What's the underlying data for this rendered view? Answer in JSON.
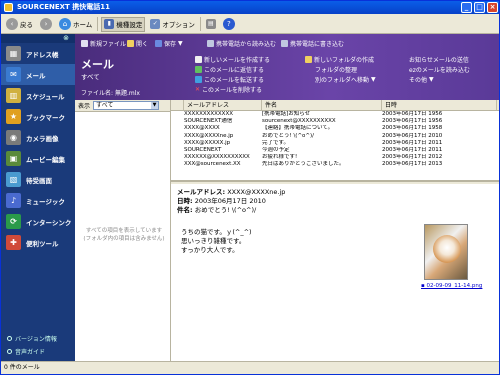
{
  "window": {
    "title": "SOURCENEXT 携快電話11"
  },
  "toolbar": {
    "back": "戻る",
    "home": "ホーム",
    "model_settings": "機種設定",
    "options": "オプション"
  },
  "sidebar": {
    "items": [
      {
        "label": "アドレス帳",
        "icon": "address-book-icon",
        "color": "#8a8a8a"
      },
      {
        "label": "メール",
        "icon": "mail-icon",
        "color": "#3a7ad0"
      },
      {
        "label": "スケジュール",
        "icon": "calendar-icon",
        "color": "#d0b040"
      },
      {
        "label": "ブックマーク",
        "icon": "star-icon",
        "color": "#e0a020"
      },
      {
        "label": "カメラ画像",
        "icon": "camera-icon",
        "color": "#7a7a7a"
      },
      {
        "label": "ムービー編集",
        "icon": "film-icon",
        "color": "#5a8a3a"
      },
      {
        "label": "待受画面",
        "icon": "wallpaper-icon",
        "color": "#4a9ad0"
      },
      {
        "label": "ミュージック",
        "icon": "music-icon",
        "color": "#4a6ad0"
      },
      {
        "label": "インターシンク",
        "icon": "sync-icon",
        "color": "#2a9a4a"
      },
      {
        "label": "便利ツール",
        "icon": "tools-icon",
        "color": "#d04a3a"
      }
    ],
    "version_info": "バージョン情報",
    "help": "音声ガイド"
  },
  "header": {
    "title": "メール",
    "subtitle": "すべて",
    "file_label": "ファイル名:",
    "file_name": "無題.mlx",
    "new_file": "新規ファイル",
    "open": "開く",
    "save": "保存",
    "read_from_phone": "携帯電話から読み込む",
    "write_to_phone": "携帯電話に書き込む",
    "actions": {
      "create_mail": "新しいメールを作成する",
      "reply": "このメールに返信する",
      "forward": "このメールを転送する",
      "delete": "このメールを削除する",
      "new_folder": "新しいフォルダの作成",
      "organize_folders": "フォルダの整理",
      "move_folder": "別のフォルダへ移動",
      "notify_send": "お知らせメールの送信",
      "read_ez_mail": "ezのメールを読み込む",
      "other": "その他"
    }
  },
  "left_pane": {
    "display_label": "表示",
    "filter_value": "すべて",
    "empty_line1": "すべての項目を表示しています",
    "empty_line2": "(フォルダ内の項目は含みません)"
  },
  "mail_list": {
    "columns": [
      "",
      "メールアドレス",
      "件名",
      "日時"
    ],
    "rows": [
      {
        "address": "XXXXXXXXXXXXX",
        "subject": "[携帯電話]お知らせ",
        "date": "2003年06月17日 1956"
      },
      {
        "address": "SOURCENEXT通信",
        "subject": "sourcenext@XXXXXXXXXX",
        "date": "2003年06月17日 1956"
      },
      {
        "address": "XXXX@XXXX",
        "subject": "【連絡】携帯電話について。",
        "date": "2003年06月17日 1958"
      },
      {
        "address": "XXXX@XXXXne.jp",
        "subject": "おめでとう! \\(^o^)/",
        "date": "2003年06月17日 2010"
      },
      {
        "address": "XXXX@XXXXX.jp",
        "subject": "完了です。",
        "date": "2003年06月17日 2011"
      },
      {
        "address": "SOURCENEXT",
        "subject": "今週の予定",
        "date": "2003年06月17日 2011"
      },
      {
        "address": "XXXXXX@XXXXXXXXXX",
        "subject": "お疲れ様です!",
        "date": "2003年06月17日 2012"
      },
      {
        "address": "XXX@sourcenext.XX",
        "subject": "先日はありがとうございました。",
        "date": "2003年06月17日 2013"
      }
    ]
  },
  "preview": {
    "address_label": "メールアドレス:",
    "address_value": "XXXX@XXXXne.jp",
    "date_label": "日時:",
    "date_value": "2003年06月17日 2010",
    "subject_label": "件名:",
    "subject_value": "おめでとう! \\(^o^)/",
    "body": "うちの猫です。ｙ(^_^)\n思いっきり雑種です。\nすっかり大人です。",
    "attachment_name": "02-09-09_11-14.png"
  },
  "status": {
    "text": "0 件のメール"
  }
}
